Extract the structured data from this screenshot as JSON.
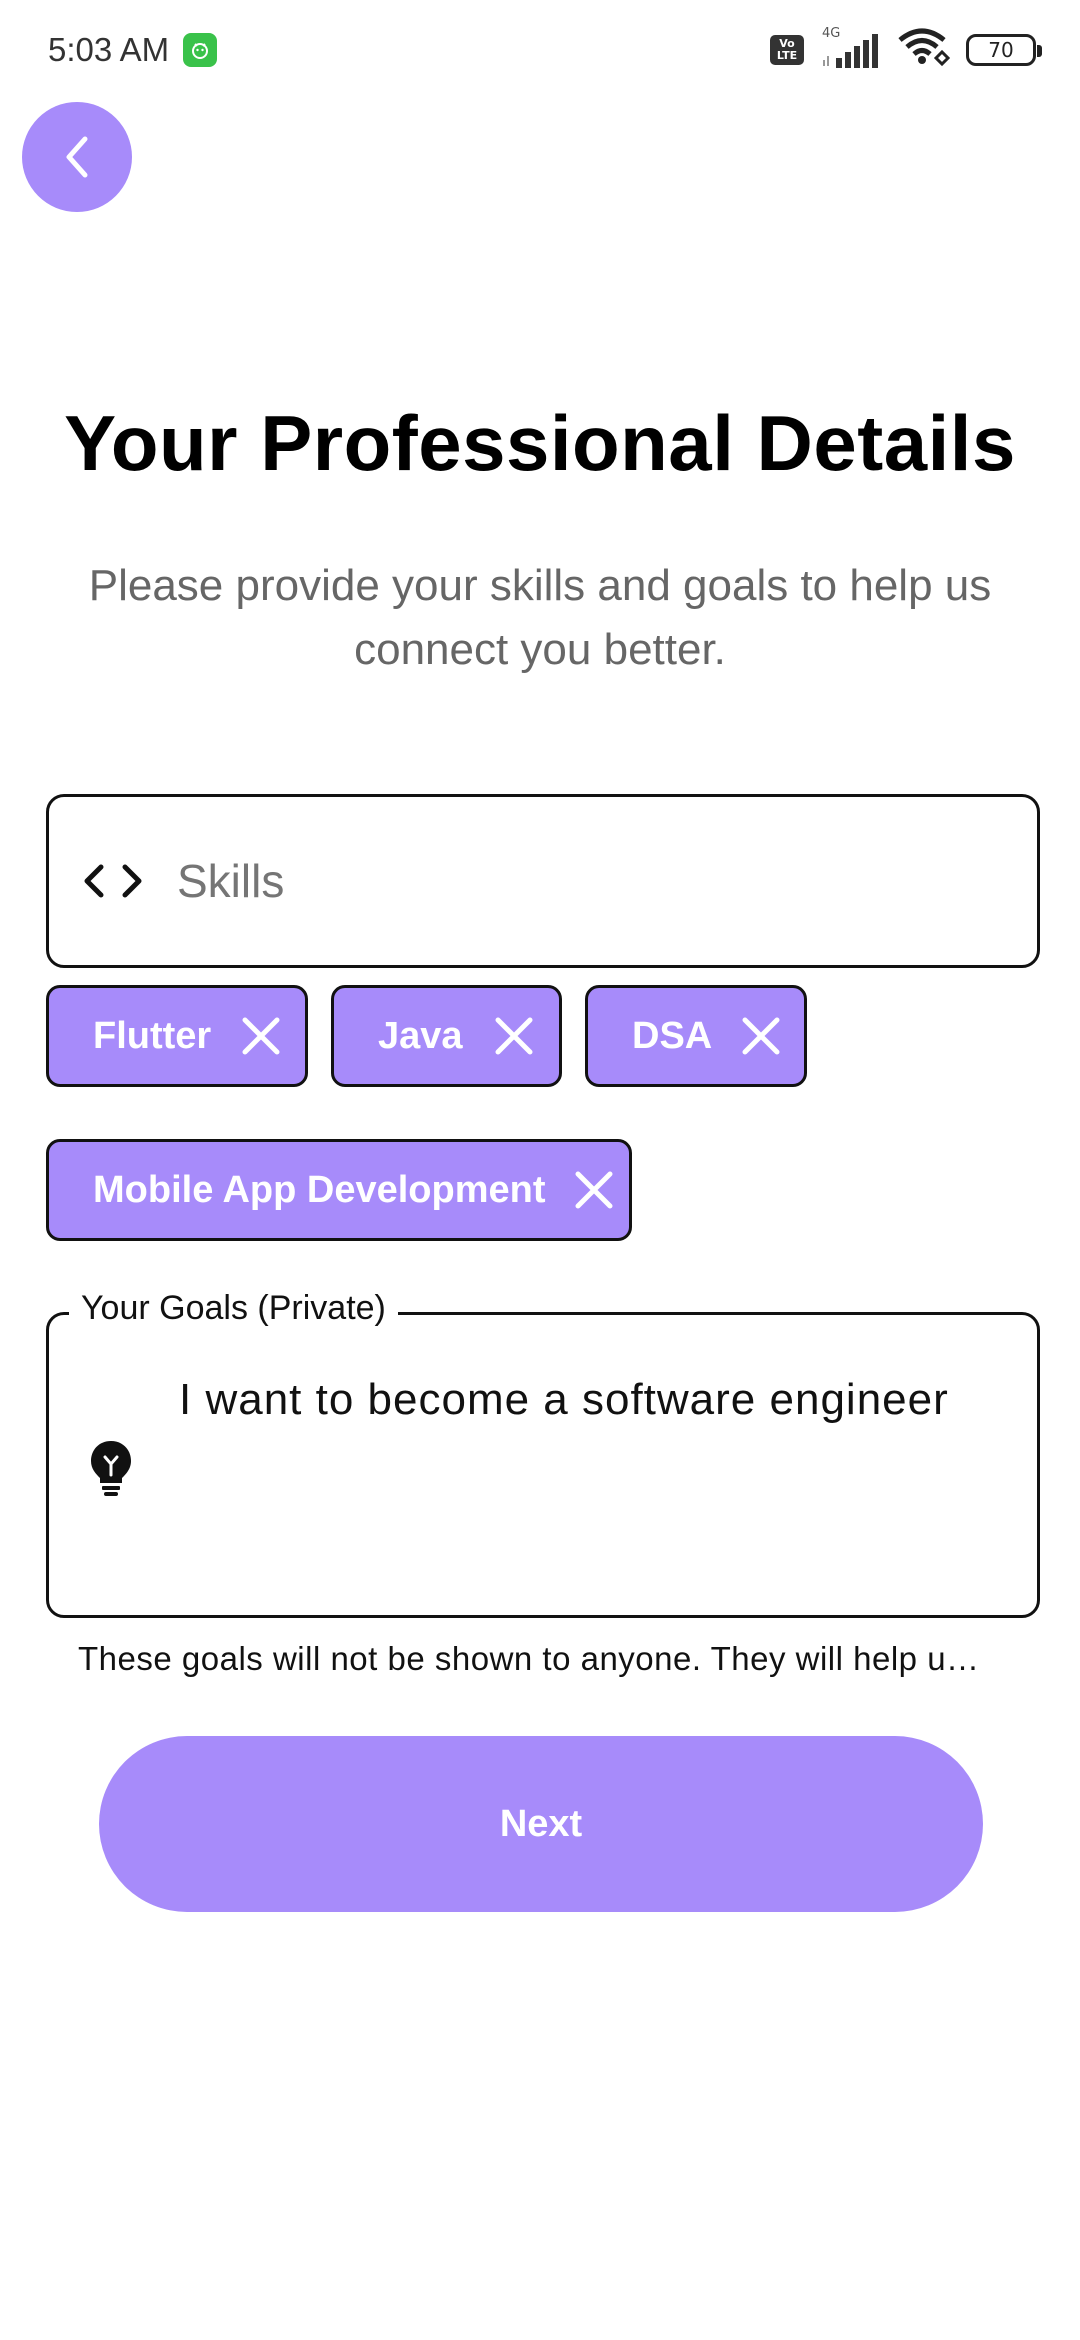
{
  "status_bar": {
    "time": "5:03 AM",
    "network": "4G",
    "volte_top": "Vo",
    "volte_bottom": "LTE",
    "battery": "70"
  },
  "header": {
    "title": "Your Professional Details",
    "subtitle": "Please provide your skills and goals to help us connect you better."
  },
  "skills": {
    "placeholder": "Skills",
    "icon": "code-icon",
    "chips": [
      {
        "label": "Flutter"
      },
      {
        "label": "Java"
      },
      {
        "label": "DSA"
      },
      {
        "label": "Mobile App Development"
      }
    ]
  },
  "goals": {
    "label": "Your Goals (Private)",
    "value": "I want to become a software engineer",
    "icon": "lightbulb-icon",
    "helper": "These goals will not be shown to anyone. They will help u…"
  },
  "actions": {
    "next_label": "Next"
  },
  "colors": {
    "accent": "#a78bfa",
    "border": "#111111",
    "subtitle": "#666666"
  }
}
